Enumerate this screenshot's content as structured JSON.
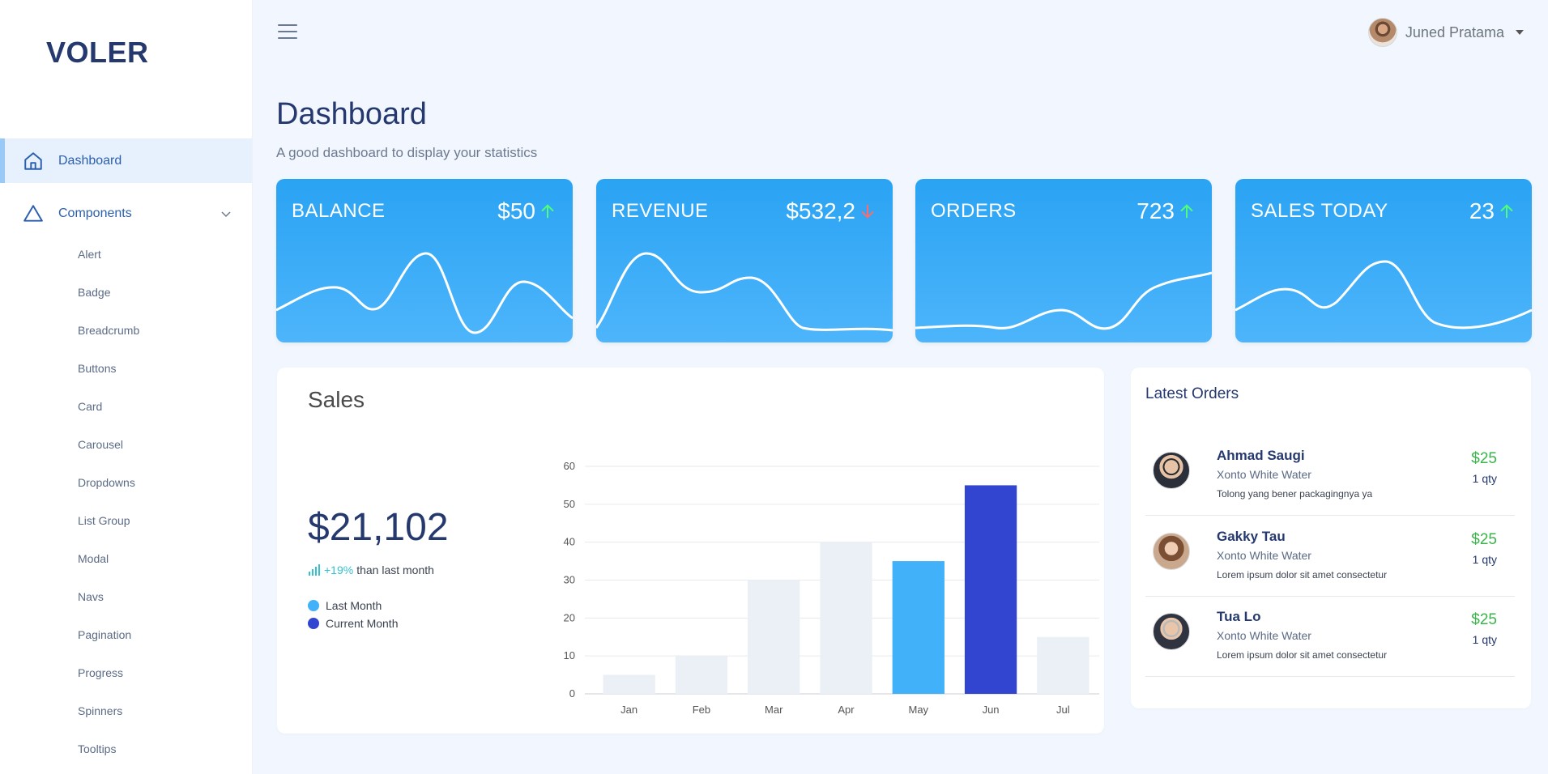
{
  "app": {
    "logo": "VOLER"
  },
  "sidebar": {
    "items": [
      {
        "label": "Dashboard",
        "icon": "home-icon",
        "active": true
      },
      {
        "label": "Components",
        "icon": "triangle-icon",
        "expanded": true
      }
    ],
    "subitems": [
      "Alert",
      "Badge",
      "Breadcrumb",
      "Buttons",
      "Card",
      "Carousel",
      "Dropdowns",
      "List Group",
      "Modal",
      "Navs",
      "Pagination",
      "Progress",
      "Spinners",
      "Tooltips"
    ]
  },
  "topbar": {
    "user_name": "Juned Pratama"
  },
  "page": {
    "title": "Dashboard",
    "subtitle": "A good dashboard to display your statistics"
  },
  "stats": [
    {
      "name": "BALANCE",
      "value": "$50",
      "trend": "up",
      "trend_color": "#4dff7a"
    },
    {
      "name": "REVENUE",
      "value": "$532,2",
      "trend": "down",
      "trend_color": "#ff6b6b"
    },
    {
      "name": "ORDERS",
      "value": "723",
      "trend": "up",
      "trend_color": "#4dff7a"
    },
    {
      "name": "SALES TODAY",
      "value": "23",
      "trend": "up",
      "trend_color": "#4dff7a"
    }
  ],
  "sales": {
    "title": "Sales",
    "total": "$21,102",
    "trend_pct": "+19%",
    "trend_text": "than last month",
    "legend": [
      {
        "label": "Last Month",
        "color": "#41b1f9"
      },
      {
        "label": "Current Month",
        "color": "#3245d1"
      }
    ]
  },
  "chart_data": {
    "type": "bar",
    "categories": [
      "Jan",
      "Feb",
      "Mar",
      "Apr",
      "May",
      "Jun",
      "Jul"
    ],
    "values": [
      5,
      10,
      30,
      40,
      35,
      55,
      15
    ],
    "bar_colors": [
      "#ebeff6",
      "#ebeff6",
      "#ebeff6",
      "#ebeff6",
      "#41b1f9",
      "#3245d1",
      "#ebeff6"
    ],
    "yticks": [
      0,
      10,
      20,
      30,
      40,
      50,
      60
    ],
    "ylim": [
      0,
      60
    ],
    "grid": true
  },
  "orders": {
    "title": "Latest Orders",
    "items": [
      {
        "name": "Ahmad Saugi",
        "product": "Xonto White Water",
        "note": "Tolong yang bener packagingnya ya",
        "price": "$25",
        "qty": "1 qty"
      },
      {
        "name": "Gakky Tau",
        "product": "Xonto White Water",
        "note": "Lorem ipsum dolor sit amet consectetur",
        "price": "$25",
        "qty": "1 qty"
      },
      {
        "name": "Tua Lo",
        "product": "Xonto White Water",
        "note": "Lorem ipsum dolor sit amet consectetur",
        "price": "$25",
        "qty": "1 qty"
      }
    ]
  }
}
